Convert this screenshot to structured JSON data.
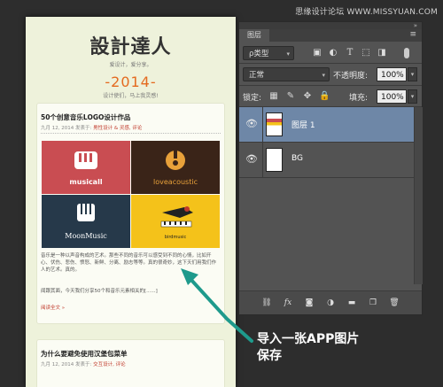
{
  "watermark": "思缘设计论坛 WWW.MISSYUAN.COM",
  "site": {
    "title": "設計達人",
    "subtitle": "爱设计，爱分享。",
    "year": "-2014-",
    "tagline": "设计使们，马上我灵感!",
    "post1": {
      "title": "50个创意音乐LOGO设计作品",
      "meta_prefix": "九月 12, 2014 发表于:",
      "meta_links": "男性设计 & 灵感, 评论",
      "logos": [
        "musicall",
        "loveacoustic",
        "MoonMusic",
        "birdmusic"
      ],
      "body1": "音乐是一种以声音构成的艺术。那些不同的音乐可以感受到不同的心情，比如开心、伏伤、悲伤、愤怒、新鲜、分离、励志等等。真的很奇妙，这下天们用我们作人的艺术。真的。",
      "body2": "闻跟其面，今天我们分享50个和音乐元素相关的[......]",
      "more": "阅读全文 »"
    },
    "post2": {
      "title": "为什么要避免使用汉堡包菜单",
      "meta_prefix": "九月 12, 2014 发表于:",
      "meta_links": "交互设计, 评论"
    }
  },
  "ps": {
    "tab": "图层",
    "filter_label": "ρ类型",
    "blend_mode": "正常",
    "opacity_label": "不透明度:",
    "opacity_value": "100%",
    "lock_label": "锁定:",
    "fill_label": "填充:",
    "fill_value": "100%",
    "layers": [
      {
        "name": "图层 1",
        "active": true
      },
      {
        "name": "BG",
        "active": false
      }
    ]
  },
  "annotation": {
    "line1": "导入一张APP图片",
    "line2": "保存"
  },
  "colors": {
    "accent_orange": "#e46a1f",
    "ps_bg": "#535353",
    "ps_selected": "#6e87a7",
    "arrow_teal": "#1e9a8c"
  }
}
